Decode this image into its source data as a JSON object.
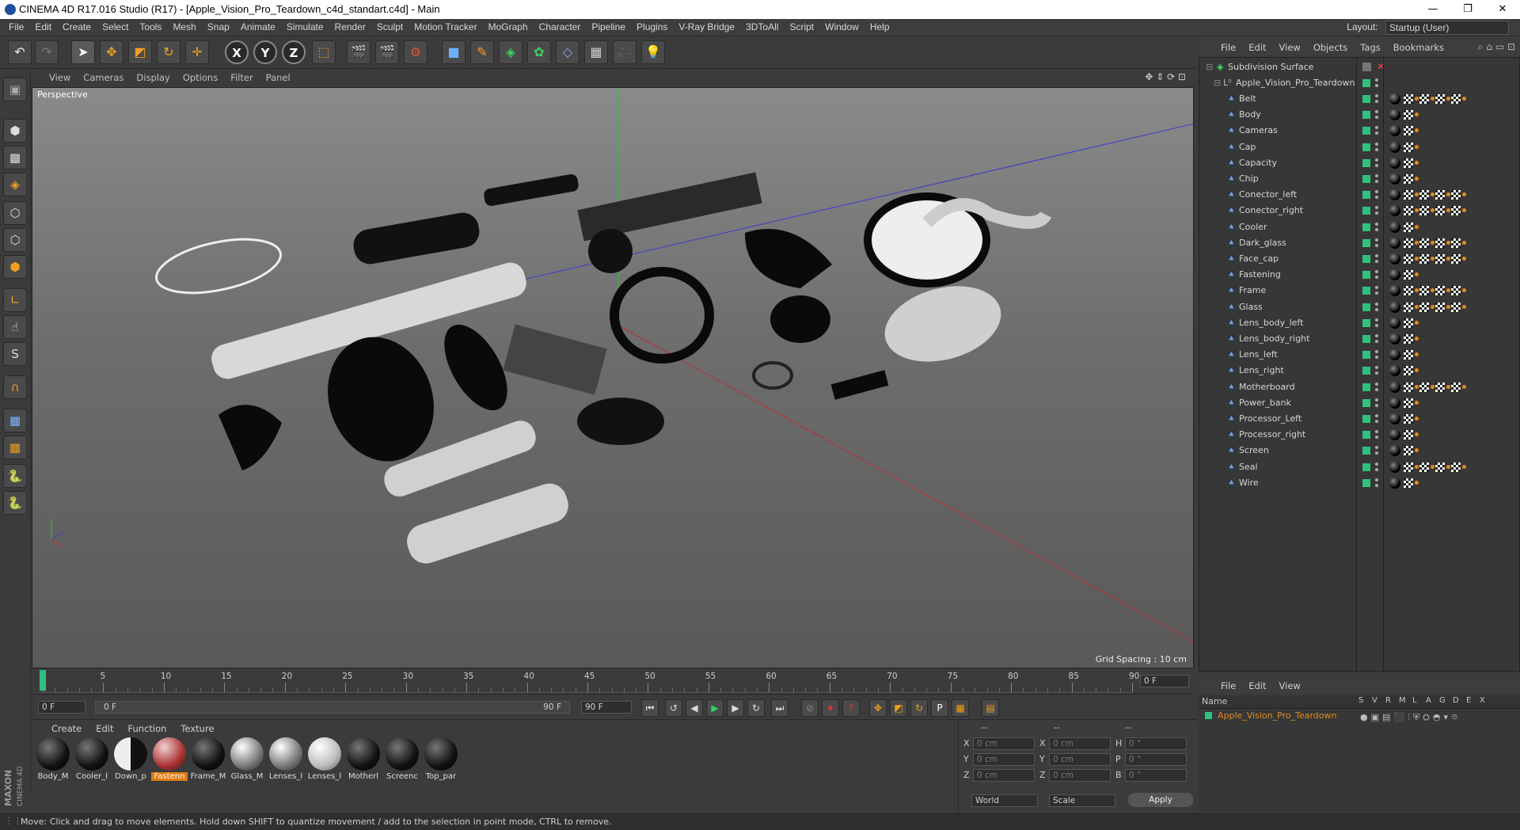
{
  "window": {
    "title": "CINEMA 4D R17.016 Studio (R17) - [Apple_Vision_Pro_Teardown_c4d_standart.c4d] - Main",
    "controls": [
      "—",
      "❐",
      "✕"
    ]
  },
  "menubar": {
    "items": [
      "File",
      "Edit",
      "Create",
      "Select",
      "Tools",
      "Mesh",
      "Snap",
      "Animate",
      "Simulate",
      "Render",
      "Sculpt",
      "Motion Tracker",
      "MoGraph",
      "Character",
      "Pipeline",
      "Plugins",
      "V-Ray Bridge",
      "3DToAll",
      "Script",
      "Window",
      "Help"
    ],
    "layout_label": "Layout:",
    "layout_value": "Startup (User)"
  },
  "viewport": {
    "menu": [
      "View",
      "Cameras",
      "Display",
      "Options",
      "Filter",
      "Panel"
    ],
    "camera_label": "Perspective",
    "grid_spacing": "Grid Spacing : 10 cm"
  },
  "timeline": {
    "ticks": [
      "0",
      "5",
      "10",
      "15",
      "20",
      "25",
      "30",
      "35",
      "40",
      "45",
      "50",
      "55",
      "60",
      "65",
      "70",
      "75",
      "80",
      "85",
      "90"
    ],
    "current_frame_right": "0 F",
    "start_field": "0 F",
    "range_start": "0 F",
    "range_end": "90 F",
    "end_field": "90 F"
  },
  "materials": {
    "menu": [
      "Create",
      "Edit",
      "Function",
      "Texture"
    ],
    "items": [
      "Body_M",
      "Cooler_l",
      "Down_p",
      "Fastenn",
      "Frame_M",
      "Glass_M",
      "Lenses_l",
      "Lenses_l",
      "Motherl",
      "Screenc",
      "Top_par"
    ],
    "active_index": 3
  },
  "coordinates": {
    "headers": [
      "--",
      "--",
      "--"
    ],
    "rows": [
      {
        "a": "X",
        "av": "0 cm",
        "b": "X",
        "bv": "0 cm",
        "c": "H",
        "cv": "0 °"
      },
      {
        "a": "Y",
        "av": "0 cm",
        "b": "Y",
        "bv": "0 cm",
        "c": "P",
        "cv": "0 °"
      },
      {
        "a": "Z",
        "av": "0 cm",
        "b": "Z",
        "bv": "0 cm",
        "c": "B",
        "cv": "0 °"
      }
    ],
    "world": "World",
    "scale": "Scale",
    "apply": "Apply"
  },
  "object_manager": {
    "menu": [
      "File",
      "Edit",
      "View",
      "Objects",
      "Tags",
      "Bookmarks"
    ],
    "root": "Subdivision Surface",
    "group": "Apple_Vision_Pro_Teardown",
    "objects": [
      "Belt",
      "Body",
      "Cameras",
      "Cap",
      "Capacity",
      "Chip",
      "Conector_left",
      "Conector_right",
      "Cooler",
      "Dark_glass",
      "Face_cap",
      "Fastening",
      "Frame",
      "Glass",
      "Lens_body_left",
      "Lens_body_right",
      "Lens_left",
      "Lens_right",
      "Motherboard",
      "Power_bank",
      "Processor_Left",
      "Processor_right",
      "Screen",
      "Seal",
      "Wire"
    ],
    "tag_counts": [
      4,
      1,
      1,
      1,
      1,
      1,
      4,
      4,
      1,
      4,
      4,
      1,
      4,
      4,
      1,
      1,
      1,
      1,
      4,
      1,
      1,
      1,
      1,
      4,
      1
    ]
  },
  "attributes": {
    "menu": [
      "File",
      "Edit",
      "View"
    ],
    "name_header": "Name",
    "col_headers": [
      "S",
      "V",
      "R",
      "M",
      "L",
      "A",
      "G",
      "D",
      "E",
      "X"
    ],
    "row_name": "Apple_Vision_Pro_Teardown"
  },
  "status": {
    "text": "Move: Click and drag to move elements. Hold down SHIFT to quantize movement / add to the selection in point mode, CTRL to remove."
  },
  "brand": {
    "name": "MAXON CINEMA 4D"
  },
  "colors": {
    "accent": "#e07a10",
    "visible_green": "#2ec27e",
    "axis_blue": "#3a3ad0",
    "axis_red": "#c03030",
    "axis_green": "#30c030"
  }
}
